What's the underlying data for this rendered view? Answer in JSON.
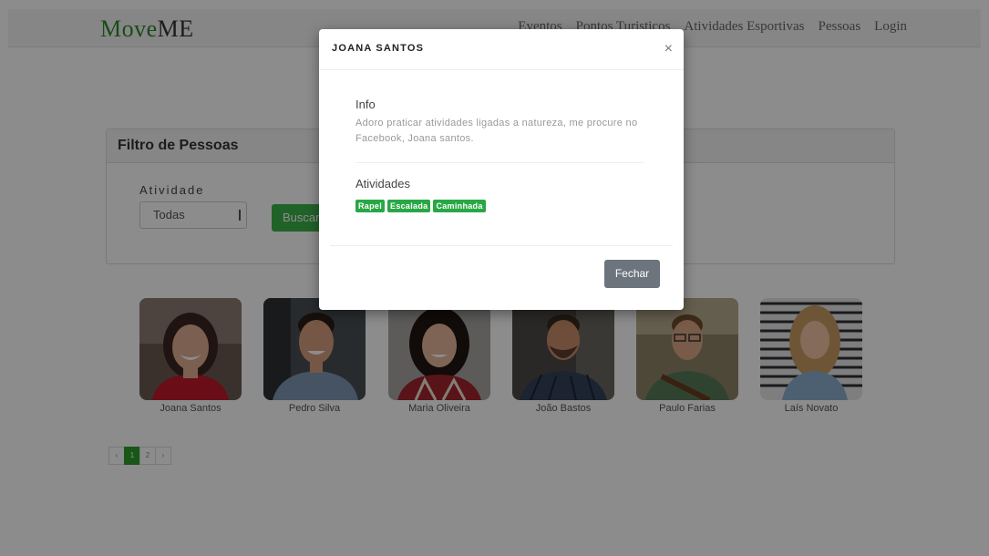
{
  "navbar": {
    "brand_move": "Move",
    "brand_me": "ME",
    "links": [
      "Eventos",
      "Pontos Turisticos",
      "Atividades Esportivas",
      "Pessoas",
      "Login"
    ]
  },
  "filter": {
    "title": "Filtro de Pessoas",
    "activity_label": "Atividade",
    "activity_selected": "Todas",
    "search_label": "Buscar"
  },
  "people": [
    {
      "name": "Joana Santos"
    },
    {
      "name": "Pedro Silva"
    },
    {
      "name": "Maria Oliveira"
    },
    {
      "name": "João Bastos"
    },
    {
      "name": "Paulo Farias"
    },
    {
      "name": "Laís Novato"
    }
  ],
  "pagination": {
    "prev": "‹",
    "pages": [
      "1",
      "2"
    ],
    "active_page": "1",
    "next": "›"
  },
  "modal": {
    "title": "JOANA SANTOS",
    "close_icon": "×",
    "info_title": "Info",
    "info_text": "Adoro praticar atividades ligadas a natureza, me procure no Facebook, Joana santos.",
    "activities_title": "Atividades",
    "activities": [
      "Rapel",
      "Escalada",
      "Caminhada"
    ],
    "close_button": "Fechar"
  },
  "colors": {
    "brand_green": "#2e8b2e",
    "button_green": "#3cb34a",
    "tag_green": "#28a745",
    "button_gray": "#6c757d"
  }
}
